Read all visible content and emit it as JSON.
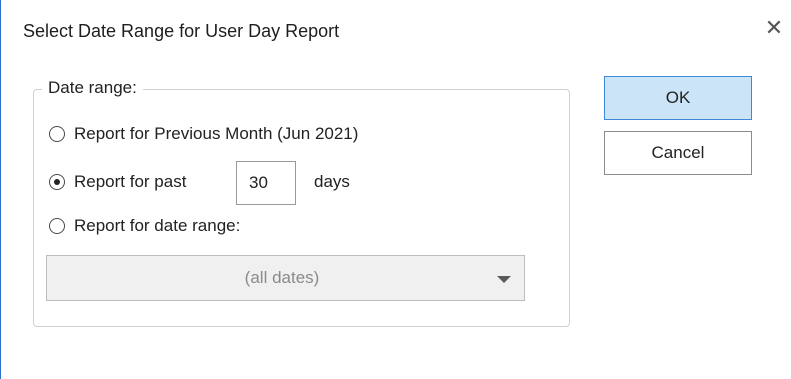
{
  "dialog": {
    "title": "Select Date Range for User Day Report",
    "close_icon": "close-icon"
  },
  "group": {
    "legend": "Date range:"
  },
  "options": [
    {
      "label": "Report for Previous Month (Jun 2021)",
      "selected": false
    },
    {
      "label": "Report for past",
      "selected": true
    },
    {
      "label": "Report for date range:",
      "selected": false
    }
  ],
  "days": {
    "value": "30",
    "suffix": "days"
  },
  "date_range_select": {
    "value": "(all dates)"
  },
  "buttons": {
    "ok": "OK",
    "cancel": "Cancel"
  },
  "colors": {
    "ok_background": "#cce4f7",
    "ok_border": "#3d8ad7",
    "window_border": "#2b72c9"
  }
}
